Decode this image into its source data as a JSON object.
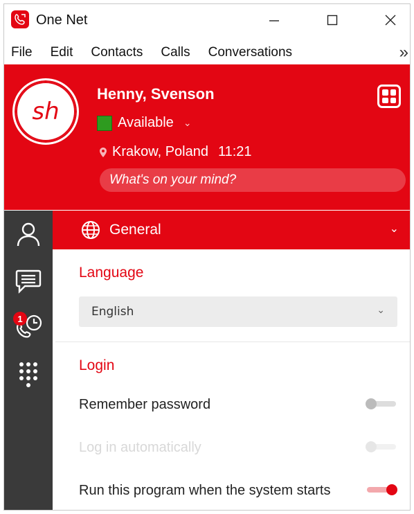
{
  "window": {
    "title": "One Net"
  },
  "menu": {
    "items": [
      "File",
      "Edit",
      "Contacts",
      "Calls",
      "Conversations"
    ],
    "more": "»"
  },
  "profile": {
    "initials": "sh",
    "name": "Henny, Svenson",
    "status": "Available",
    "status_color": "#2e9b1f",
    "location": "Krakow, Poland",
    "time": "11:21",
    "mind_placeholder": "What's on your mind?"
  },
  "sidebar": {
    "icons": [
      "contacts-icon",
      "conversations-icon",
      "call-history-icon",
      "dialpad-icon"
    ],
    "call_history_badge": "1"
  },
  "general": {
    "title": "General",
    "language_label": "Language",
    "language_value": "English",
    "login_label": "Login",
    "options": [
      {
        "label": "Remember password",
        "state": "off",
        "enabled": true
      },
      {
        "label": "Log in automatically",
        "state": "off",
        "enabled": false
      },
      {
        "label": "Run this program when the system starts",
        "state": "on",
        "enabled": true
      }
    ]
  },
  "colors": {
    "accent": "#e30613",
    "sidebar": "#3a3a3a"
  }
}
